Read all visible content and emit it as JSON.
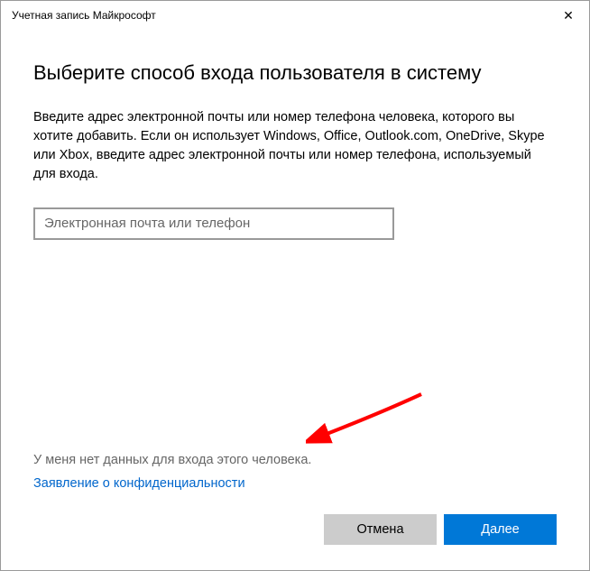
{
  "titlebar": {
    "title": "Учетная запись Майкрософт"
  },
  "main": {
    "heading": "Выберите способ входа пользователя в систему",
    "description": "Введите адрес электронной почты или номер телефона человека, которого вы хотите добавить. Если он использует Windows, Office, Outlook.com, OneDrive, Skype или Xbox, введите адрес электронной почты или номер телефона, используемый для входа.",
    "input_placeholder": "Электронная почта или телефон",
    "input_value": ""
  },
  "links": {
    "no_signin_info": "У меня нет данных для входа этого человека.",
    "privacy": "Заявление о конфиденциальности"
  },
  "buttons": {
    "cancel": "Отмена",
    "next": "Далее"
  }
}
